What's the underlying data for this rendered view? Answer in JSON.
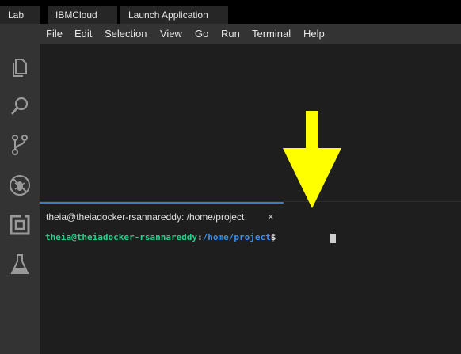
{
  "top_tabs": [
    {
      "label": "Lab"
    },
    {
      "label": "IBMCloud"
    },
    {
      "label": "Launch Application"
    }
  ],
  "menu": {
    "items": [
      "File",
      "Edit",
      "Selection",
      "View",
      "Go",
      "Run",
      "Terminal",
      "Help"
    ]
  },
  "activity_bar": {
    "icons": [
      "explorer-icon",
      "search-icon",
      "source-control-icon",
      "debug-icon",
      "extensions-icon",
      "lab-flask-icon"
    ]
  },
  "terminal": {
    "tab_title": "theia@theiadocker-rsannareddy: /home/project",
    "close_glyph": "×",
    "prompt_user": "theia@theiadocker-rsannareddy",
    "prompt_sep": ":",
    "prompt_path": "/home/project",
    "prompt_dollar": "$"
  },
  "colors": {
    "annotation_arrow": "#ffff00",
    "prompt_user": "#23d18b",
    "prompt_path": "#3b8eea",
    "active_tab_border": "#3a7dc2"
  }
}
